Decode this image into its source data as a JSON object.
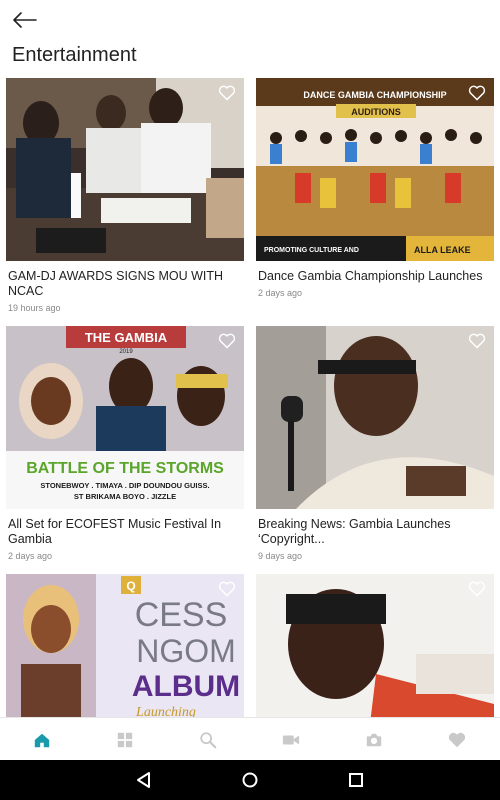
{
  "header": {
    "title": "Entertainment"
  },
  "articles": [
    {
      "title": "GAM-DJ AWARDS SIGNS MOU WITH NCAC",
      "time": "19 hours ago"
    },
    {
      "title": "Dance Gambia Championship Launches",
      "time": "2 days ago",
      "image_text": {
        "top": "DANCE GAMBIA CHAMPIONSHIP",
        "badge": "AUDITIONS",
        "bottom_left": "PROMOTING CULTURE AND",
        "bottom_right": "ALLA LEAKE"
      }
    },
    {
      "title": "All Set for ECOFEST Music Festival In Gambia",
      "time": "2 days ago",
      "image_text": {
        "top": "THE GAMBIA",
        "year": "2019",
        "headline": "BATTLE OF THE STORMS",
        "line1": "STONEBWOY . TIMAYA . DIP DOUNDOU GUISS.",
        "line2": "ST BRIKAMA BOYO . JIZZLE"
      }
    },
    {
      "title": "Breaking News: Gambia Launches ‘Copyright...",
      "time": "9 days ago"
    },
    {
      "title": "",
      "time": "",
      "image_text": {
        "brand": "Q",
        "line1": "CESS",
        "line2": "NGOM",
        "line3": "ALBUM",
        "line4": "Launching"
      }
    },
    {
      "title": "",
      "time": ""
    }
  ],
  "nav": {
    "items": [
      "home",
      "categories",
      "search",
      "video",
      "photo",
      "favorites"
    ],
    "active": "home"
  },
  "colors": {
    "accent": "#1a9bab",
    "nav_icon": "#c9c9c9",
    "title": "#222222",
    "meta": "#888888"
  }
}
